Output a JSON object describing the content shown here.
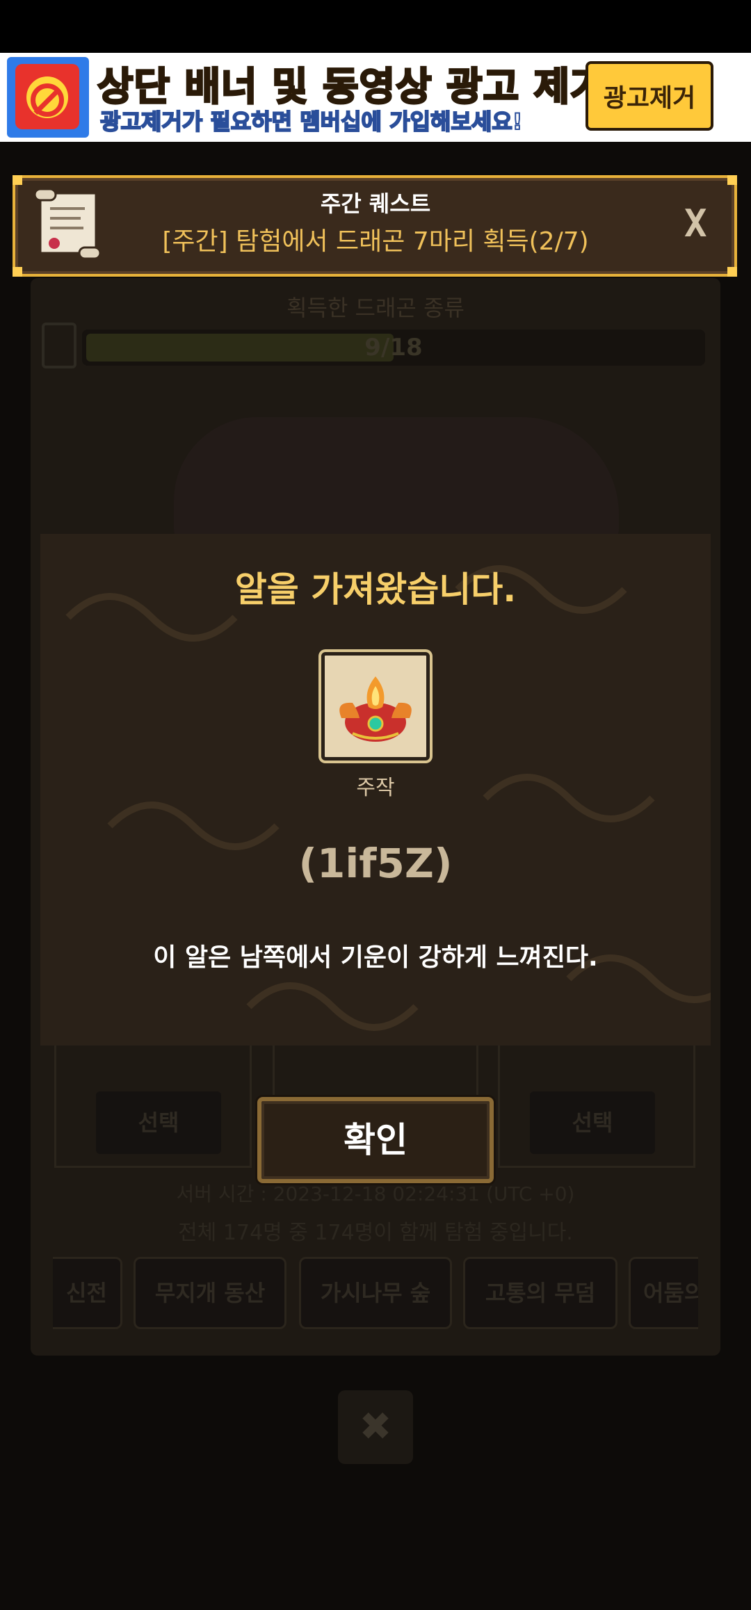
{
  "ad_banner": {
    "title": "상단 배너 및 동영상 광고 제거!",
    "subtitle": "광고제거가 필요하면 멤버십에 가입해보세요!",
    "button_label": "광고제거"
  },
  "quest": {
    "title": "주간 퀘스트",
    "description": "[주간] 탐험에서 드래곤 7마리 획득(2/7)",
    "close_label": "X"
  },
  "background": {
    "collection_title": "획득한 드래곤 종류",
    "progress_text": "9/18",
    "progress_fraction": 0.5,
    "select_labels": [
      "선택",
      "선택"
    ],
    "server_time": "서버 시간 : 2023-12-18 02:24:31 (UTC +0)",
    "player_count": "전체 174명 중 174명이 함께 탐험 중입니다.",
    "tabs": [
      "신전",
      "무지개 동산",
      "가시나무 숲",
      "고통의 무덤",
      "어둠의"
    ],
    "close_symbol": "✖"
  },
  "modal": {
    "title": "알을 가져왔습니다.",
    "egg_name": "주작",
    "egg_code": "(1if5Z)",
    "description": "이 알은 남쪽에서 기운이 강하게 느껴진다.",
    "confirm_label": "확인"
  },
  "colors": {
    "accent_gold": "#f7cf6a",
    "quest_text": "#f0c15a",
    "ad_yellow": "#ffc93a"
  }
}
